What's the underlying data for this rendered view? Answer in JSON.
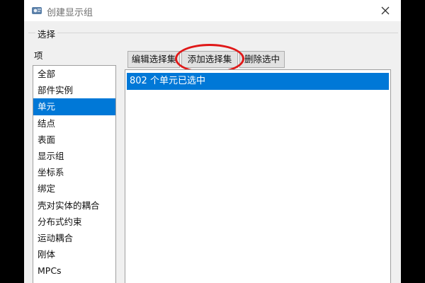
{
  "window": {
    "title": "创建显示组",
    "icon": "app-icon",
    "close_icon": "close-icon"
  },
  "selection": {
    "group_label": "选择",
    "items_label": "项",
    "items": [
      {
        "label": "全部",
        "selected": false
      },
      {
        "label": "部件实例",
        "selected": false
      },
      {
        "label": "单元",
        "selected": true
      },
      {
        "label": "结点",
        "selected": false
      },
      {
        "label": "表面",
        "selected": false
      },
      {
        "label": "显示组",
        "selected": false
      },
      {
        "label": "坐标系",
        "selected": false
      },
      {
        "label": "绑定",
        "selected": false
      },
      {
        "label": "壳对实体的耦合",
        "selected": false
      },
      {
        "label": "分布式约束",
        "selected": false
      },
      {
        "label": "运动耦合",
        "selected": false
      },
      {
        "label": "刚体",
        "selected": false
      },
      {
        "label": "MPCs",
        "selected": false
      }
    ]
  },
  "toolbar": {
    "edit_label": "编辑选择集",
    "add_label": "添加选择集",
    "delete_label": "删除选中"
  },
  "selected_panel": {
    "row_text": "802 个单元已选中"
  },
  "colors": {
    "selection_blue": "#0078d7",
    "highlight_red": "#e01818"
  }
}
